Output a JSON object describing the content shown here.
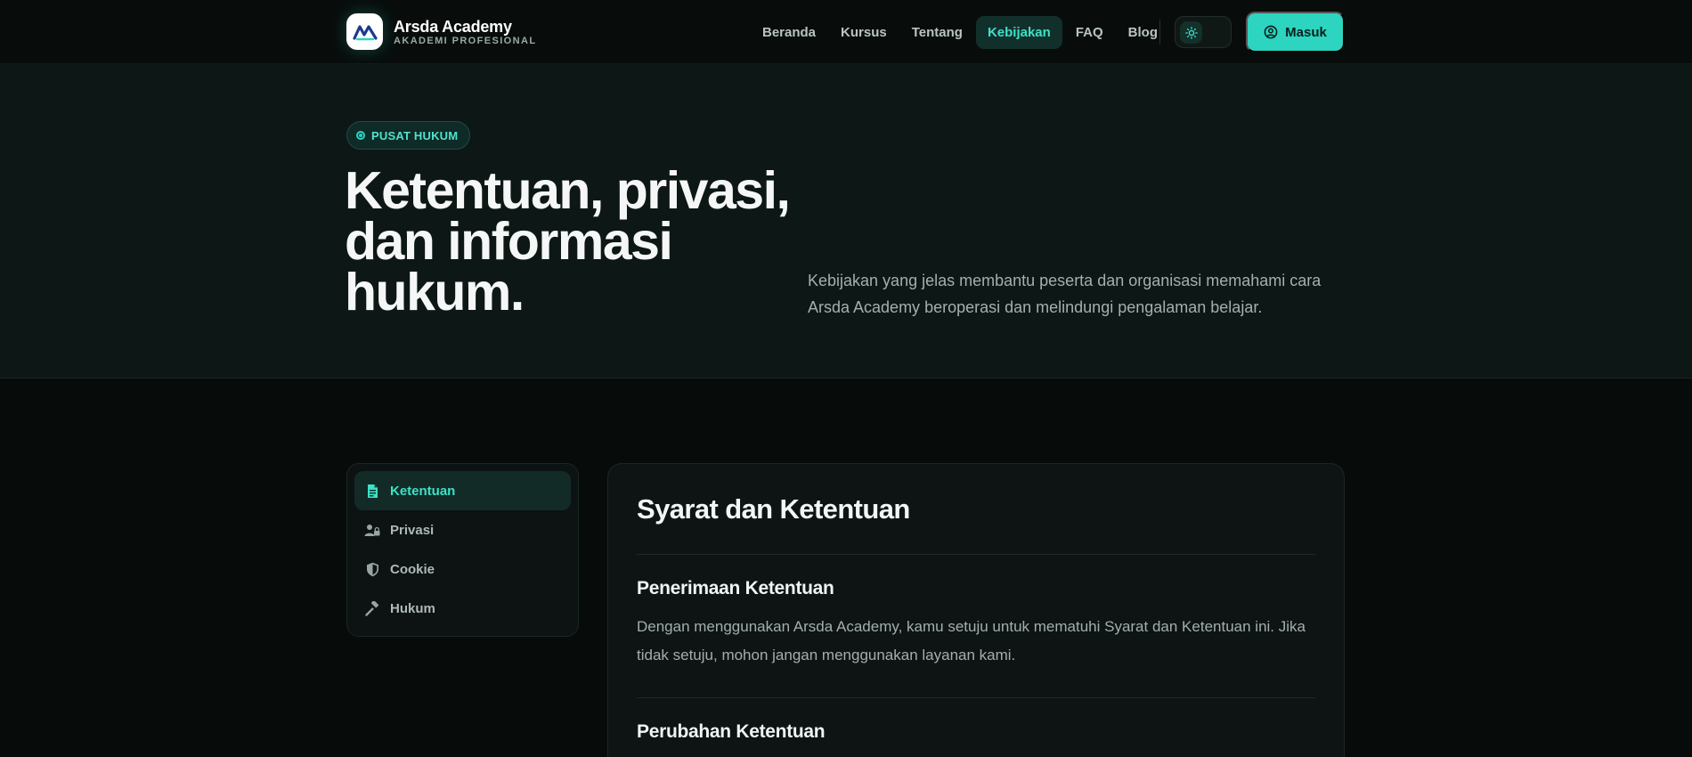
{
  "brand": {
    "name": "Arsda Academy",
    "tagline": "AKADEMI PROFESIONAL"
  },
  "nav": {
    "items": [
      "Beranda",
      "Kursus",
      "Tentang",
      "Kebijakan",
      "FAQ",
      "Blog"
    ],
    "active": "Kebijakan"
  },
  "header": {
    "login_label": "Masuk"
  },
  "hero": {
    "badge": "PUSAT HUKUM",
    "title": "Ketentuan, privasi, dan informasi hukum.",
    "description": "Kebijakan yang jelas membantu peserta dan organisasi memahami cara Arsda Academy beroperasi dan melindungi pengalaman belajar."
  },
  "sidebar": {
    "items": [
      {
        "label": "Ketentuan",
        "icon": "document-icon",
        "active": true
      },
      {
        "label": "Privasi",
        "icon": "user-lock-icon",
        "active": false
      },
      {
        "label": "Cookie",
        "icon": "shield-icon",
        "active": false
      },
      {
        "label": "Hukum",
        "icon": "gavel-icon",
        "active": false
      }
    ]
  },
  "content": {
    "title": "Syarat dan Ketentuan",
    "sections": [
      {
        "heading": "Penerimaan Ketentuan",
        "body": "Dengan menggunakan Arsda Academy, kamu setuju untuk mematuhi Syarat dan Ketentuan ini. Jika tidak setuju, mohon jangan menggunakan layanan kami."
      },
      {
        "heading": "Perubahan Ketentuan",
        "body": ""
      }
    ]
  },
  "colors": {
    "accent": "#2dd4bf",
    "background": "#070c0b",
    "hero_background": "#0d1715"
  }
}
